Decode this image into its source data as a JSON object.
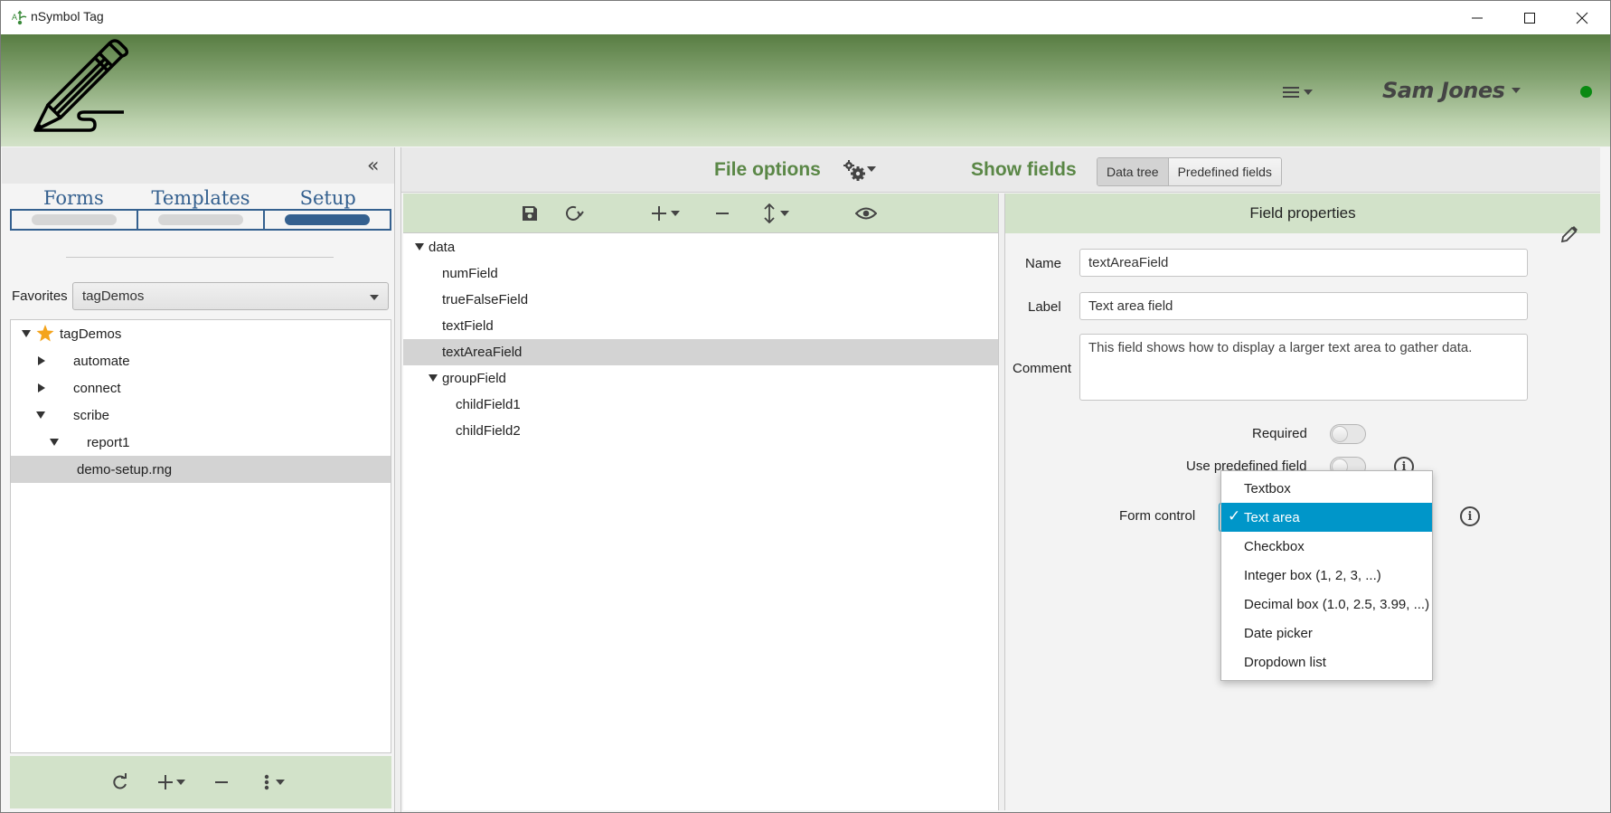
{
  "window": {
    "title": "nSymbol Tag",
    "icon": "app-logo-icon",
    "controls": [
      "minimize-icon",
      "maximize-icon",
      "close-icon"
    ]
  },
  "header": {
    "logo_icon": "pencil-logo-icon",
    "menu_icon": "hamburger-menu-icon",
    "user_name": "Sam Jones",
    "status_color": "#0a8a12"
  },
  "sidebar": {
    "collapse_icon": "double-chevron-left-icon",
    "nav_tabs": [
      {
        "label": "Forms",
        "active": false
      },
      {
        "label": "Templates",
        "active": false
      },
      {
        "label": "Setup",
        "active": true
      }
    ],
    "favorites_label": "Favorites",
    "favorites_value": "tagDemos",
    "tree": [
      {
        "label": "tagDemos",
        "level": 0,
        "expanded": true,
        "starred": true
      },
      {
        "label": "automate",
        "level": 1,
        "expanded": false
      },
      {
        "label": "connect",
        "level": 1,
        "expanded": false
      },
      {
        "label": "scribe",
        "level": 1,
        "expanded": true
      },
      {
        "label": "report1",
        "level": 2,
        "expanded": true
      },
      {
        "label": "demo-setup.rng",
        "level": 3,
        "selected": true
      }
    ],
    "footer_icons": [
      "refresh-icon",
      "add-dropdown-icon",
      "remove-icon",
      "more-vertical-icon"
    ]
  },
  "toolbar": {
    "file_options_label": "File options",
    "show_fields_label": "Show fields",
    "segments": [
      {
        "label": "Data tree",
        "active": true
      },
      {
        "label": "Predefined fields",
        "active": false
      }
    ]
  },
  "data_tree": {
    "toolbar_icons": [
      "save-icon",
      "reload-icon",
      "add-dropdown-icon",
      "remove-icon",
      "move-dropdown-icon",
      "preview-eye-icon"
    ],
    "nodes": [
      {
        "label": "data",
        "level": 0,
        "expanded": true
      },
      {
        "label": "numField",
        "level": 1
      },
      {
        "label": "trueFalseField",
        "level": 1
      },
      {
        "label": "textField",
        "level": 1
      },
      {
        "label": "textAreaField",
        "level": 1,
        "selected": true
      },
      {
        "label": "groupField",
        "level": 1,
        "expanded": true
      },
      {
        "label": "childField1",
        "level": 2
      },
      {
        "label": "childField2",
        "level": 2
      }
    ]
  },
  "field_properties": {
    "title": "Field properties",
    "name_label": "Name",
    "name_value": "textAreaField",
    "label_label": "Label",
    "label_value": "Text area field",
    "comment_label": "Comment",
    "comment_value": "This field shows how to display a larger text area to gather data.",
    "required_label": "Required",
    "required_on": false,
    "predefined_label": "Use predefined field",
    "predefined_on": false,
    "form_control_label": "Form control",
    "form_control_options": [
      "Textbox",
      "Text area",
      "Checkbox",
      "Integer box (1, 2, 3, ...)",
      "Decimal box (1.0, 2.5, 3.99, ...)",
      "Date picker",
      "Dropdown list"
    ],
    "form_control_selected": "Text area",
    "selected_color": "#0096c9"
  }
}
